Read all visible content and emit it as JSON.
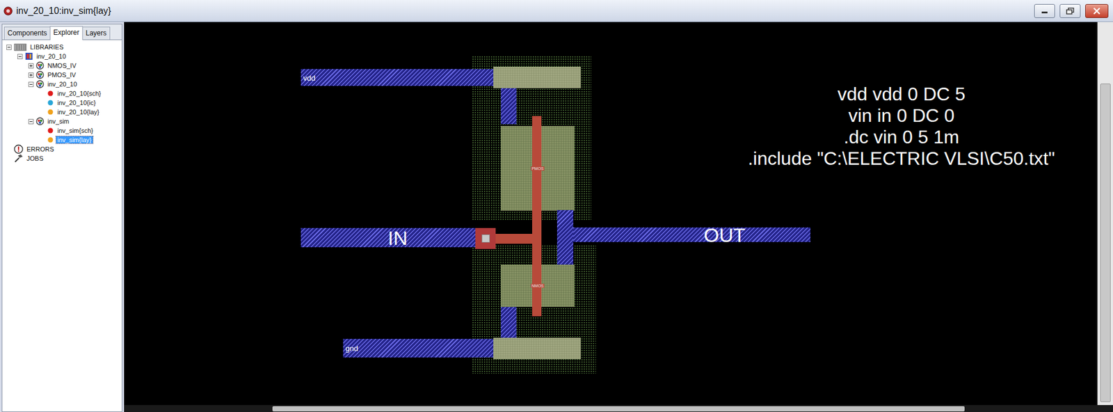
{
  "window": {
    "title": "inv_20_10:inv_sim{lay}"
  },
  "tabs": [
    {
      "label": "Components",
      "selected": false
    },
    {
      "label": "Explorer",
      "selected": true
    },
    {
      "label": "Layers",
      "selected": false
    }
  ],
  "tree": [
    {
      "label": "LIBRARIES",
      "kind": "libraries",
      "expanded": true,
      "selected": false,
      "children": [
        {
          "label": "inv_20_10",
          "kind": "library",
          "expanded": true,
          "selected": false,
          "children": [
            {
              "label": "NMOS_IV",
              "kind": "cell",
              "expanded": false,
              "selected": false,
              "children": []
            },
            {
              "label": "PMOS_IV",
              "kind": "cell",
              "expanded": false,
              "selected": false,
              "children": []
            },
            {
              "label": "inv_20_10",
              "kind": "cell",
              "expanded": true,
              "selected": false,
              "children": [
                {
                  "label": "inv_20_10{sch}",
                  "kind": "view",
                  "color": "#e01b1b",
                  "selected": false
                },
                {
                  "label": "inv_20_10{ic}",
                  "kind": "view",
                  "color": "#2aa7d8",
                  "selected": false
                },
                {
                  "label": "inv_20_10{lay}",
                  "kind": "view",
                  "color": "#f0a21c",
                  "selected": false
                }
              ]
            },
            {
              "label": "inv_sim",
              "kind": "cell",
              "expanded": true,
              "selected": false,
              "children": [
                {
                  "label": "inv_sim{sch}",
                  "kind": "view",
                  "color": "#e01b1b",
                  "selected": false
                },
                {
                  "label": "inv_sim{lay}",
                  "kind": "view",
                  "color": "#f0a21c",
                  "selected": true
                }
              ]
            }
          ]
        }
      ]
    },
    {
      "label": "ERRORS",
      "kind": "errors",
      "selected": false
    },
    {
      "label": "JOBS",
      "kind": "jobs",
      "selected": false
    }
  ],
  "canvas": {
    "vdd_label": "vdd",
    "gnd_label": "gnd",
    "in_label": "IN",
    "out_label": "OUT",
    "transistors": [
      {
        "label": "PMOS",
        "kind": "pmos"
      },
      {
        "label": "NMOS",
        "kind": "nmos"
      }
    ],
    "spice": [
      "vdd vdd 0 DC 5",
      "vin in 0 DC 0",
      ".dc vin 0 5 1m",
      ".include \"C:\\ELECTRIC VLSI\\C50.txt\""
    ]
  },
  "scrollbars": {
    "horizontal_level": 0.7,
    "vertical_level": 0.83
  }
}
